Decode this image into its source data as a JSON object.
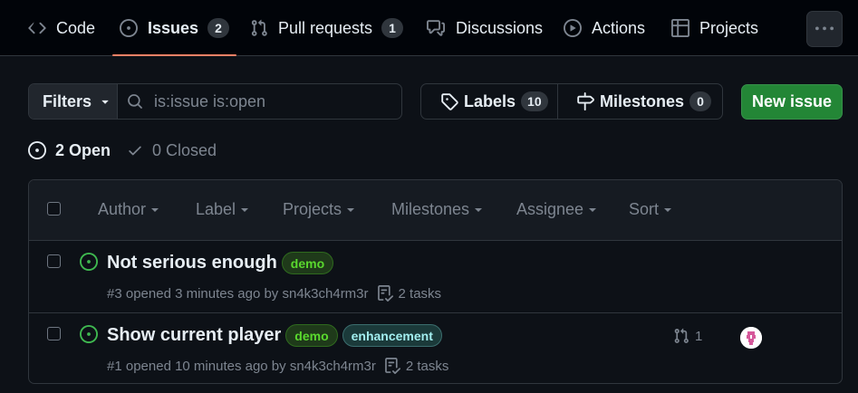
{
  "nav": {
    "tabs": [
      {
        "label": "Code",
        "icon": "code-icon"
      },
      {
        "label": "Issues",
        "icon": "issue-opened-icon",
        "counter": "2"
      },
      {
        "label": "Pull requests",
        "icon": "git-pull-request-icon",
        "counter": "1"
      },
      {
        "label": "Discussions",
        "icon": "comment-discussion-icon"
      },
      {
        "label": "Actions",
        "icon": "play-icon"
      },
      {
        "label": "Projects",
        "icon": "table-icon"
      }
    ],
    "active_tab": "Issues",
    "more_icon": "kebab-horizontal-icon"
  },
  "toolbar": {
    "filters_label": "Filters",
    "search_placeholder": "is:issue is:open",
    "labels_label": "Labels",
    "labels_count": "10",
    "milestones_label": "Milestones",
    "milestones_count": "0",
    "new_issue_label": "New issue"
  },
  "states": {
    "open_label": "2 Open",
    "closed_label": "0 Closed"
  },
  "list_header": {
    "filters": [
      "Author",
      "Label",
      "Projects",
      "Milestones",
      "Assignee",
      "Sort"
    ]
  },
  "issues": [
    {
      "title": "Not serious enough",
      "labels": [
        "demo"
      ],
      "meta": "#3 opened 3 minutes ago by sn4k3ch4rm3r",
      "tasks": "2 tasks"
    },
    {
      "title": "Show current player",
      "labels": [
        "demo",
        "enhancement"
      ],
      "meta": "#1 opened 10 minutes ago by sn4k3ch4rm3r",
      "tasks": "2 tasks",
      "linked_prs": "1"
    }
  ],
  "colors": {
    "background": "#0d1117",
    "open_green": "#3fb950",
    "primary_button": "#238636",
    "active_underline": "#f78166",
    "label_demo": "#5ad82e",
    "label_enhancement": "#a2eeef"
  }
}
